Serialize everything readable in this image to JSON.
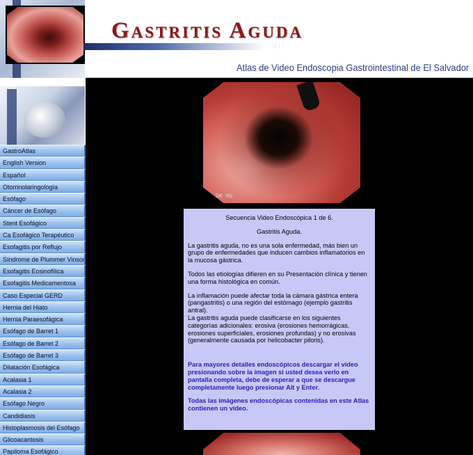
{
  "header": {
    "title": "Gastritis Aguda",
    "subtitle": "Atlas de Video Endoscopia Gastrointestinal de El Salvador"
  },
  "sidebar": {
    "items": [
      "GastroAtlas",
      "English Version",
      "Español",
      "Otorrinolaringología",
      "Esófago",
      "Cáncer de Esófago",
      "Stent Esofágico",
      "Ca Esofágico Terapéutico",
      "Esofagitis por Reflujo",
      "Síndrome de Plummer Vinson",
      "Esofagitis Eosinofílica",
      "Esofagitis Medicamentosa",
      "Caso Especial GERD",
      "Hernia del Hiato",
      "Hernia Paraesofágica",
      "Esófago de Barret 1",
      "Esófago de Barret 2",
      "Esófago de Barret 3",
      "Dilatación Esofágica",
      "Acalasia 1",
      "Acalasia 2",
      "Esófago Negro",
      "Candidiasis",
      "Histoplasmosis del Esófago",
      "Glicoacantosis",
      "Papiloma Esofágico"
    ]
  },
  "video": {
    "watermark": "DR MU"
  },
  "description": {
    "sequence": "Secuencia Video Endoscópica 1 de 6.",
    "heading": "Gastritis Aguda.",
    "p1": "La gastritis aguda, no es una sola enfermedad, más bien un grupo de enfermedades que inducen cambios inflamatorios en la mucosa gástrica.",
    "p2": "Todos las etiologías difieren en su Presentación clínica y tienen una forma histológica en común.",
    "p3": "La inflamación puede afectar toda la cámara gástrica entera (pangastritis) o una región del estómago (ejemplo gastritis antral).",
    "p4": "La gastritis aguda puede clasificarse en los siguientes categorías adicionales: erosiva (erosiones hemorrágicas, erosiones superficiales, erosiones profundas) y no erosivas (generalmente causada por helicobacter piloris).",
    "p5": "Para mayores detalles endoscópicos descargar el video presionando sobre la imagen si usted desea verlo en pantalla completa, debe de esperar a que se descargue completamente luego presionar Alt y Enter.",
    "p6": "Todas las imágenes endoscópicas contenidas en este Atlas contienen un video."
  }
}
